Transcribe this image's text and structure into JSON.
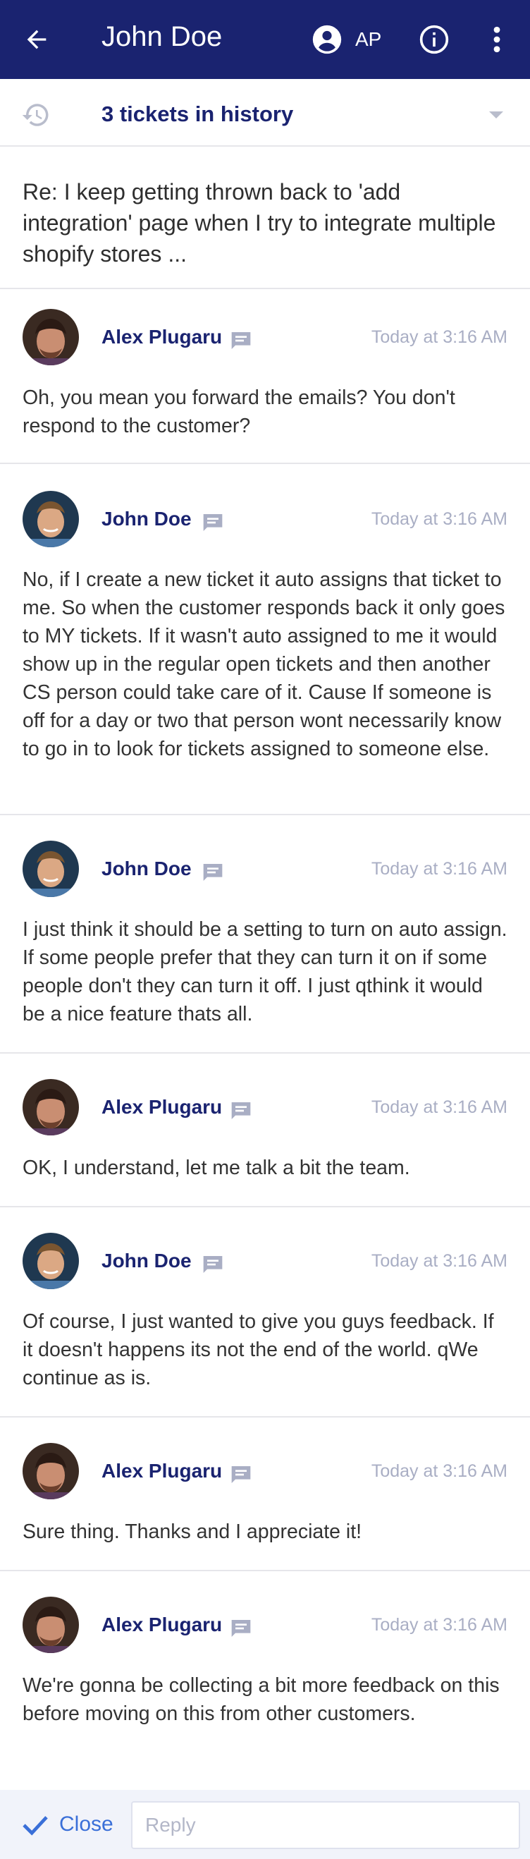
{
  "header": {
    "title": "John Doe",
    "initials": "AP",
    "bg_color": "#1a2370"
  },
  "history": {
    "label": "3 tickets in history"
  },
  "ticket": {
    "subject": "Re: I keep getting thrown back to 'add integration' page when I try to integrate multiple shopify stores ..."
  },
  "messages": [
    {
      "author": "Alex Plugaru",
      "time": "Today at 3:16 AM",
      "body": "Oh, you mean you forward the emails? You don't respond to the customer?"
    },
    {
      "author": "John Doe",
      "time": "Today at 3:16 AM",
      "body": "No, if I create a new ticket it auto assigns that ticket to me. So when the customer responds back it only goes to MY tickets. If it wasn't auto assigned to me it would show up in the regular open tickets and then another CS person could take care of it. Cause If someone is off for a day or two that person wont necessarily know to go in to look for tickets assigned to someone else."
    },
    {
      "author": "John Doe",
      "time": "Today at 3:16 AM",
      "body": "I just think it should be a setting to turn on auto assign. If some people prefer that they can turn it on if some people don't they can turn it off. I just qthink it would be a nice feature thats all."
    },
    {
      "author": "Alex Plugaru",
      "time": "Today at 3:16 AM",
      "body": "OK, I understand, let me talk a bit the team."
    },
    {
      "author": "John Doe",
      "time": "Today at 3:16 AM",
      "body": "Of course, I just wanted to give you guys feedback. If it doesn't happens its not the end of the world. qWe continue as is."
    },
    {
      "author": "Alex Plugaru",
      "time": "Today at 3:16 AM",
      "body": "Sure thing. Thanks and I appreciate it!"
    },
    {
      "author": "Alex Plugaru",
      "time": "Today at 3:16 AM",
      "body": "We're gonna be collecting a bit more feedback on this before moving on this from other customers."
    }
  ],
  "footer": {
    "close_label": "Close",
    "reply_placeholder": "Reply"
  },
  "icons": {
    "back": "arrow-back-icon",
    "user": "account-circle-icon",
    "info": "info-icon",
    "more": "more-vert-icon",
    "history": "history-icon",
    "caret": "caret-down-icon",
    "chat": "chat-icon",
    "check": "check-icon"
  },
  "colors": {
    "primary": "#1a2370",
    "accent": "#3a6fd8",
    "muted": "#a9aec4"
  }
}
